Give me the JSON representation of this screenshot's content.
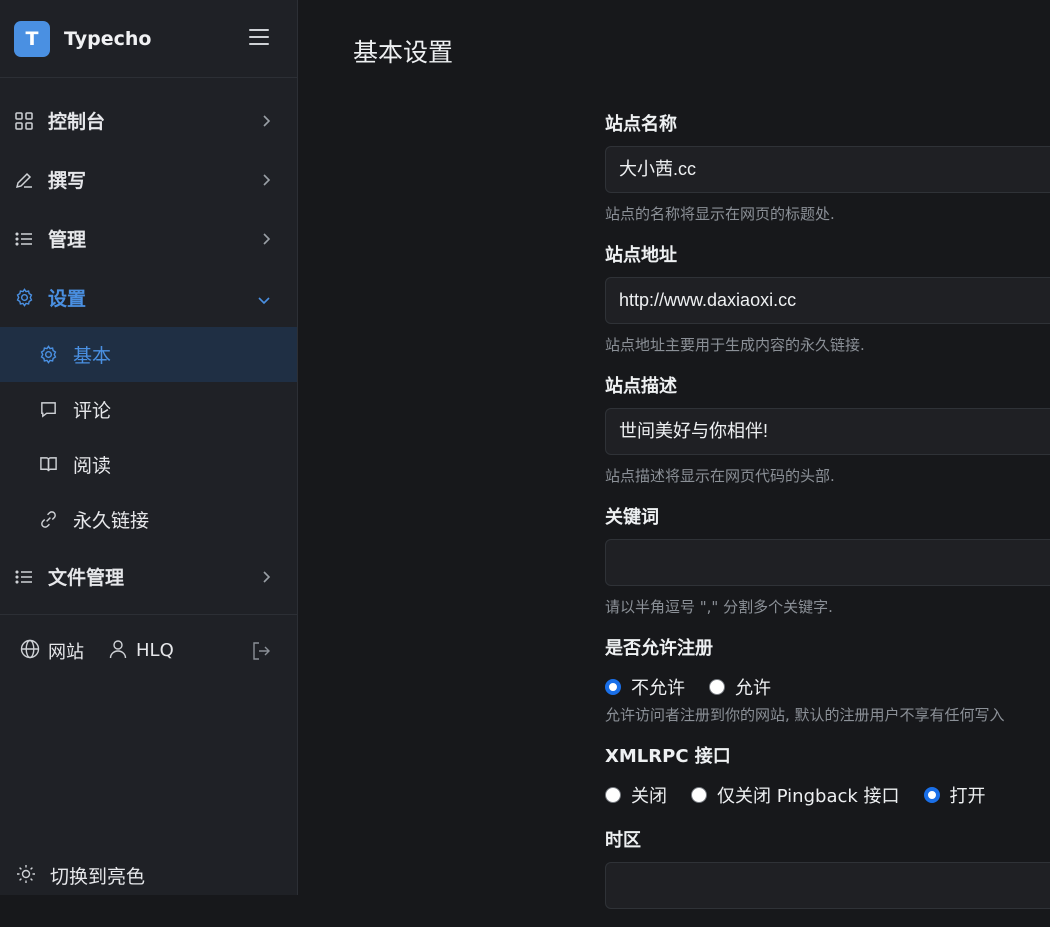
{
  "brand": {
    "logo_letter": "T",
    "name": "Typecho"
  },
  "nav": {
    "dashboard": "控制台",
    "write": "撰写",
    "manage": "管理",
    "settings": "设置",
    "settings_sub": {
      "basic": "基本",
      "comments": "评论",
      "reading": "阅读",
      "permalink": "永久链接"
    },
    "files": "文件管理"
  },
  "footer": {
    "site": "网站",
    "user": "HLQ"
  },
  "theme_toggle": "切换到亮色",
  "page": {
    "title": "基本设置"
  },
  "form": {
    "site_name": {
      "label": "站点名称",
      "value": "大小茜.cc",
      "help": "站点的名称将显示在网页的标题处."
    },
    "site_url": {
      "label": "站点地址",
      "value": "http://www.daxiaoxi.cc",
      "help": "站点地址主要用于生成内容的永久链接."
    },
    "site_desc": {
      "label": "站点描述",
      "value": "世间美好与你相伴!",
      "help": "站点描述将显示在网页代码的头部."
    },
    "keywords": {
      "label": "关键词",
      "value": "",
      "help": "请以半角逗号 \",\" 分割多个关键字."
    },
    "register": {
      "label": "是否允许注册",
      "options": [
        "不允许",
        "允许"
      ],
      "selected": "不允许",
      "help": "允许访问者注册到你的网站, 默认的注册用户不享有任何写入"
    },
    "xmlrpc": {
      "label": "XMLRPC 接口",
      "options": [
        "关闭",
        "仅关闭 Pingback 接口",
        "打开"
      ],
      "selected": "打开"
    },
    "timezone": {
      "label": "时区"
    }
  },
  "colors": {
    "accent": "#4a90e2",
    "radio": "#1a6fe8",
    "bg": "#17181b",
    "sidebar": "#1f2126"
  }
}
